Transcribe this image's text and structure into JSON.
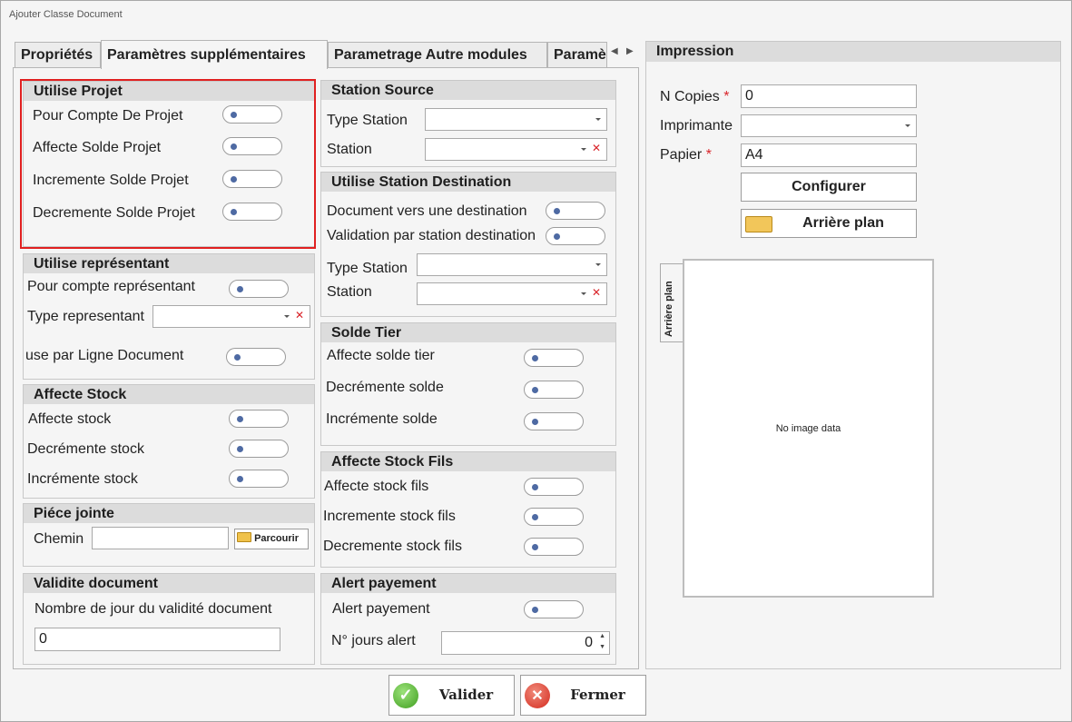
{
  "window": {
    "title": "Ajouter Classe Document"
  },
  "tabs": [
    "Propriétés",
    "Paramètres supplémentaires",
    "Parametrage Autre modules",
    "Paramè"
  ],
  "utilise_projet": {
    "title": "Utilise Projet",
    "pour_compte": "Pour Compte De Projet",
    "affecte": "Affecte Solde Projet",
    "incremente": "Incremente Solde Projet",
    "decremente": "Decremente Solde Projet"
  },
  "representant": {
    "title": "Utilise représentant",
    "pour_compte": "Pour compte représentant",
    "type": "Type representant",
    "par_ligne": "use par Ligne Document"
  },
  "affecte_stock": {
    "title": "Affecte Stock",
    "affecte": "Affecte stock",
    "decremente": "Decrémente stock",
    "incremente": "Incrémente stock"
  },
  "piece_jointe": {
    "title": "Piéce jointe",
    "chemin": "Chemin",
    "parcourir": "Parcourir"
  },
  "validite": {
    "title": "Validite document",
    "label": "Nombre de jour du validité document",
    "value": "0"
  },
  "station_source": {
    "title": "Station Source",
    "type_station": "Type Station",
    "station": "Station"
  },
  "station_dest": {
    "title": "Utilise Station Destination",
    "vers_dest": "Document vers une destination",
    "validation": "Validation par station destination",
    "type_station": "Type Station",
    "station": "Station"
  },
  "solde_tier": {
    "title": "Solde Tier",
    "affecte": "Affecte solde tier",
    "decremente": "Decrémente solde",
    "incremente": "Incrémente solde"
  },
  "stock_fils": {
    "title": "Affecte Stock Fils",
    "affecte": "Affecte stock fils",
    "incremente": "Incremente stock fils",
    "decremente": "Decremente stock fils"
  },
  "alert": {
    "title": "Alert payement",
    "alert_label": "Alert payement",
    "jours_label": "N° jours alert",
    "jours_value": "0"
  },
  "impression": {
    "title": "Impression",
    "n_copies_label": "N Copies",
    "n_copies_value": "0",
    "imprimante_label": "Imprimante",
    "papier_label": "Papier",
    "papier_value": "A4",
    "configurer": "Configurer",
    "arriere_plan": "Arrière plan",
    "side_tab": "Arrière plan",
    "no_image": "No image data",
    "required_mark": "*"
  },
  "footer": {
    "valider": "Valider",
    "fermer": "Fermer"
  },
  "colors": {
    "highlight": "#e02020",
    "toggle_dot": "#4e6aa3",
    "group_header": "#dcdcdc"
  }
}
